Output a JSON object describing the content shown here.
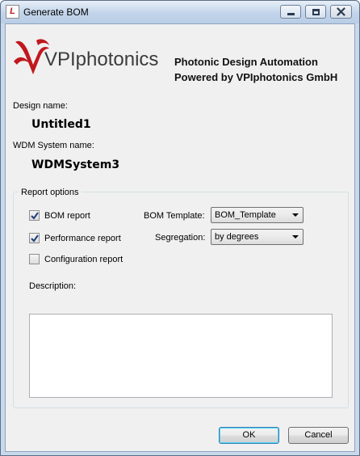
{
  "window": {
    "title": "Generate BOM",
    "app_icon_letter": "L"
  },
  "header": {
    "logo_text": "VPIphotonics",
    "tagline_line1": "Photonic Design Automation",
    "tagline_line2": "Powered by VPIphotonics GmbH",
    "logo_color": "#c0181e"
  },
  "design": {
    "name_label": "Design name:",
    "name_value": "Untitled1",
    "wdm_label": "WDM System name:",
    "wdm_value": "WDMSystem3"
  },
  "report_options": {
    "group_title": "Report options",
    "bom_report": {
      "label": "BOM  report",
      "checked": true
    },
    "performance_report": {
      "label": "Performance report",
      "checked": true
    },
    "configuration_report": {
      "label": "Configuration report",
      "checked": false
    },
    "bom_template_label": "BOM Template:",
    "bom_template_value": "BOM_Template",
    "segregation_label": "Segregation:",
    "segregation_value": "by degrees",
    "description_label": "Description:",
    "description_value": ""
  },
  "buttons": {
    "ok": "OK",
    "cancel": "Cancel"
  }
}
